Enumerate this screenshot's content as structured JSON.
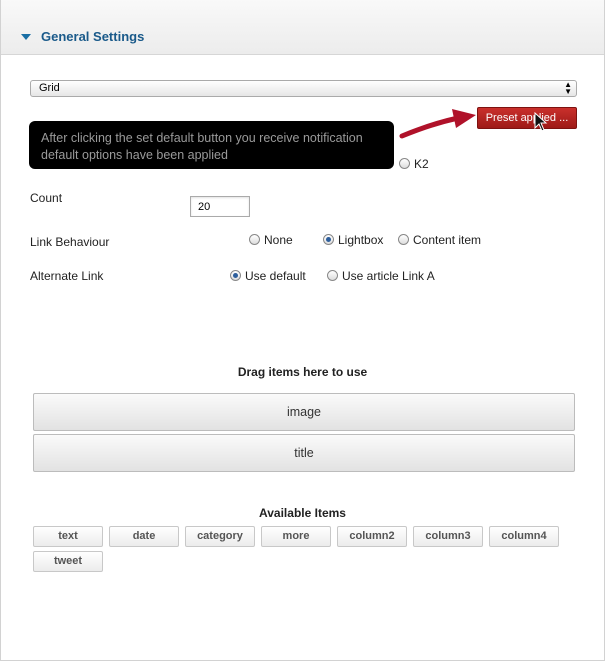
{
  "header": {
    "title": "General Settings"
  },
  "select": {
    "value": "Grid"
  },
  "preset_button": {
    "label": "Preset applied ..."
  },
  "tooltip": {
    "line1": "After clicking the set default button you receive notification",
    "line2": "default options have been applied"
  },
  "source_option": {
    "label": "K2"
  },
  "count": {
    "label": "Count",
    "value": "20"
  },
  "link_behaviour": {
    "label": "Link Behaviour",
    "options": [
      {
        "label": "None",
        "selected": false
      },
      {
        "label": "Lightbox",
        "selected": true
      },
      {
        "label": "Content item",
        "selected": false
      }
    ]
  },
  "alternate_link": {
    "label": "Alternate Link",
    "options": [
      {
        "label": "Use default",
        "selected": true
      },
      {
        "label": "Use article Link A",
        "selected": false
      }
    ]
  },
  "drag_area": {
    "title": "Drag items here to use",
    "items": [
      "image",
      "title"
    ]
  },
  "available": {
    "title": "Available Items",
    "items": [
      "text",
      "date",
      "category",
      "more",
      "column2",
      "column3",
      "column4",
      "tweet"
    ]
  },
  "colors": {
    "accent": "#1a5a8a",
    "button": "#b52521",
    "arrow": "#b0122a"
  }
}
